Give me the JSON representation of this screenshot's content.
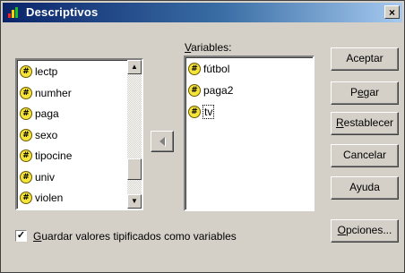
{
  "window": {
    "title": "Descriptivos",
    "close_glyph": "×"
  },
  "source_list": {
    "items": [
      {
        "label": "lectp",
        "icon": "scale-variable-icon"
      },
      {
        "label": "numher",
        "icon": "scale-variable-icon"
      },
      {
        "label": "paga",
        "icon": "scale-variable-icon"
      },
      {
        "label": "sexo",
        "icon": "scale-variable-icon"
      },
      {
        "label": "tipocine",
        "icon": "scale-variable-icon"
      },
      {
        "label": "univ",
        "icon": "scale-variable-icon"
      },
      {
        "label": "violen",
        "icon": "scale-variable-icon"
      }
    ]
  },
  "variables": {
    "label_prefix": "V",
    "label_rest": "ariables:",
    "items": [
      {
        "label": "fútbol",
        "icon": "scale-variable-icon"
      },
      {
        "label": "paga2",
        "icon": "scale-variable-icon"
      },
      {
        "label": "tv",
        "icon": "scale-variable-icon"
      }
    ]
  },
  "buttons": {
    "accept": "Aceptar",
    "paste_a": "P",
    "paste_u": "e",
    "paste_b": "gar",
    "reset_u": "R",
    "reset_b": "establecer",
    "cancel": "Cancelar",
    "help": "Ayuda",
    "options_u": "O",
    "options_b": "pciones..."
  },
  "checkbox": {
    "checked": true,
    "mark": "✓",
    "label_u": "G",
    "label_rest": "uardar valores tipificados como variables"
  },
  "colors": {
    "title_start": "#0a246a",
    "title_end": "#a6caf0",
    "face": "#d4d0c8",
    "variable_icon": "#f5e43a"
  }
}
